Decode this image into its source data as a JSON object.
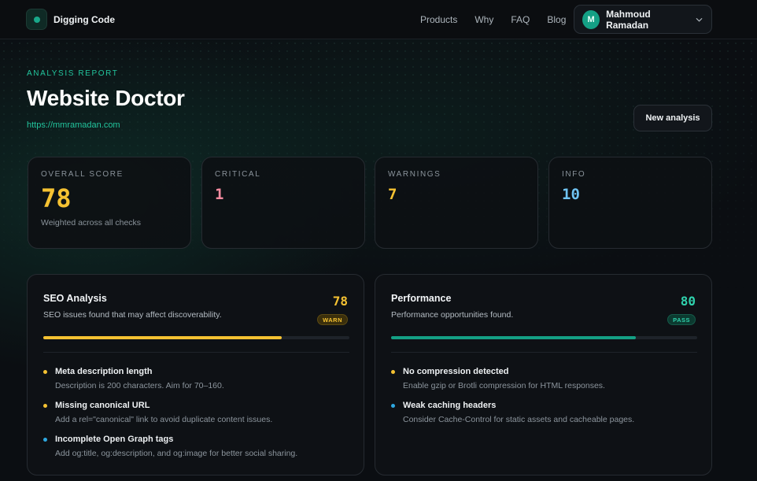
{
  "nav": {
    "brand": "Digging Code",
    "links": [
      "Products",
      "Why",
      "FAQ",
      "Blog"
    ],
    "user": {
      "initial": "M",
      "name": "Mahmoud Ramadan"
    }
  },
  "header": {
    "kicker": "ANALYSIS REPORT",
    "title": "Website Doctor",
    "url": "https://mmramadan.com",
    "new_button": "New analysis"
  },
  "stats": {
    "overall": {
      "label": "OVERALL SCORE",
      "value": "78",
      "sub": "Weighted across all checks"
    },
    "critical": {
      "label": "CRITICAL",
      "value": "1"
    },
    "warnings": {
      "label": "WARNINGS",
      "value": "7"
    },
    "info": {
      "label": "INFO",
      "value": "10"
    }
  },
  "colors": {
    "accent": "#22c59d",
    "warn": "#f5c232",
    "critical": "#f78ba0",
    "info": "#6fc3f2",
    "pass": "#14a085"
  },
  "panels": {
    "seo": {
      "title": "SEO Analysis",
      "desc": "SEO issues found that may affect discoverability.",
      "score": "78",
      "badge": "WARN",
      "progress": 0.78,
      "issues": [
        {
          "title": "Meta description length",
          "desc": "Description is 200 characters. Aim for 70–160.",
          "level": "warning"
        },
        {
          "title": "Missing canonical URL",
          "desc": "Add a rel=\"canonical\" link to avoid duplicate content issues.",
          "level": "warning"
        },
        {
          "title": "Incomplete Open Graph tags",
          "desc": "Add og:title, og:description, and og:image for better social sharing.",
          "level": "info"
        }
      ]
    },
    "performance": {
      "title": "Performance",
      "desc": "Performance opportunities found.",
      "score": "80",
      "badge": "PASS",
      "progress": 0.8,
      "issues": [
        {
          "title": "No compression detected",
          "desc": "Enable gzip or Brotli compression for HTML responses.",
          "level": "warning"
        },
        {
          "title": "Weak caching headers",
          "desc": "Consider Cache-Control for static assets and cacheable pages.",
          "level": "info"
        }
      ]
    }
  }
}
